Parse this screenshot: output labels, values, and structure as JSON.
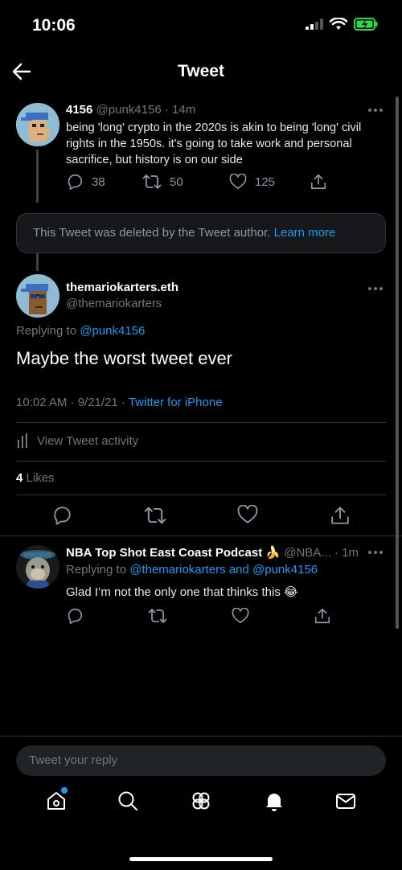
{
  "status_bar": {
    "time": "10:06"
  },
  "header": {
    "title": "Tweet"
  },
  "parent_tweet": {
    "name": "4156",
    "handle": "@punk4156",
    "time": "· 14m",
    "text": "being 'long' crypto in the 2020s is akin to being 'long' civil rights in the 1950s. it's going to take work and personal sacrifice, but history is on our side",
    "replies": "38",
    "retweets": "50",
    "likes": "125"
  },
  "deleted_notice": {
    "text": "This Tweet was deleted by the Tweet author.",
    "link": "Learn more"
  },
  "main_tweet": {
    "name": "themariokarters.eth",
    "handle": "@themariokarters",
    "replying_prefix": "Replying to",
    "replying_to": "@punk4156",
    "text": "Maybe the worst tweet ever",
    "timestamp": "10:02 AM · 9/21/21 ·",
    "source": "Twitter for iPhone",
    "activity_label": "View Tweet activity",
    "likes_count": "4",
    "likes_label": "Likes"
  },
  "reply_tweet": {
    "name": "NBA Top Shot East Coast Podcast",
    "emoji": "🍌",
    "handle_time": "@NBA... · 1m",
    "replying_prefix": "Replying to",
    "replying_to": "@themariokarters and @punk4156",
    "text": "Glad I’m not the only one that thinks this",
    "text_emoji": "😂"
  },
  "compose": {
    "placeholder": "Tweet your reply"
  },
  "tabs": [
    "home-icon",
    "search-icon",
    "communities-icon",
    "notifications-icon",
    "messages-icon"
  ],
  "colors": {
    "accent": "#1d9bf0",
    "background": "#000000",
    "battery": "#32d74b"
  }
}
